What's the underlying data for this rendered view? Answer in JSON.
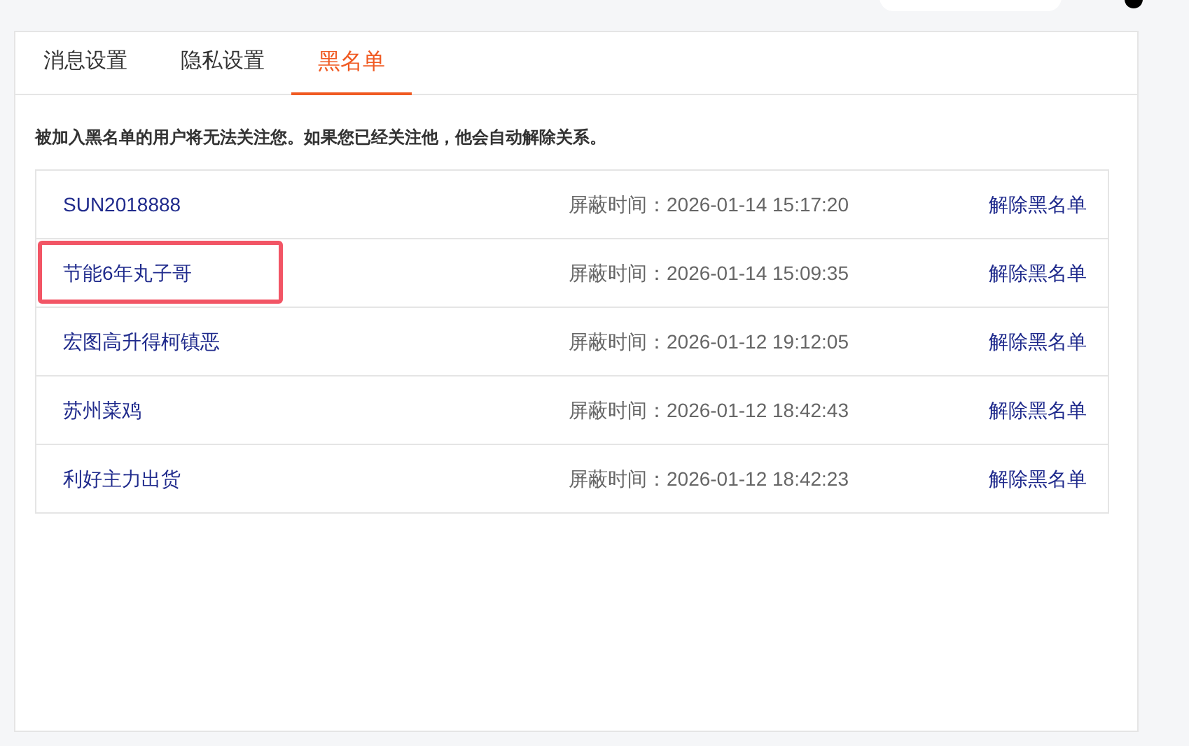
{
  "tabs": [
    {
      "label": "消息设置",
      "selected": false
    },
    {
      "label": "隐私设置",
      "selected": false
    },
    {
      "label": "黑名单",
      "selected": true
    }
  ],
  "notice": "被加入黑名单的用户将无法关注您。如果您已经关注他，他会自动解除关系。",
  "blocked_users": [
    {
      "name": "SUN2018888",
      "blocked_time": "屏蔽时间：2026-01-14 15:17:20",
      "action": "解除黑名单",
      "highlighted": false
    },
    {
      "name": "节能6年丸子哥",
      "blocked_time": "屏蔽时间：2026-01-14 15:09:35",
      "action": "解除黑名单",
      "highlighted": true
    },
    {
      "name": "宏图高升得柯镇恶",
      "blocked_time": "屏蔽时间：2026-01-12 19:12:05",
      "action": "解除黑名单",
      "highlighted": false
    },
    {
      "name": "苏州菜鸡",
      "blocked_time": "屏蔽时间：2026-01-12 18:42:43",
      "action": "解除黑名单",
      "highlighted": false
    },
    {
      "name": "利好主力出货",
      "blocked_time": "屏蔽时间：2026-01-12 18:42:23",
      "action": "解除黑名单",
      "highlighted": false
    }
  ]
}
